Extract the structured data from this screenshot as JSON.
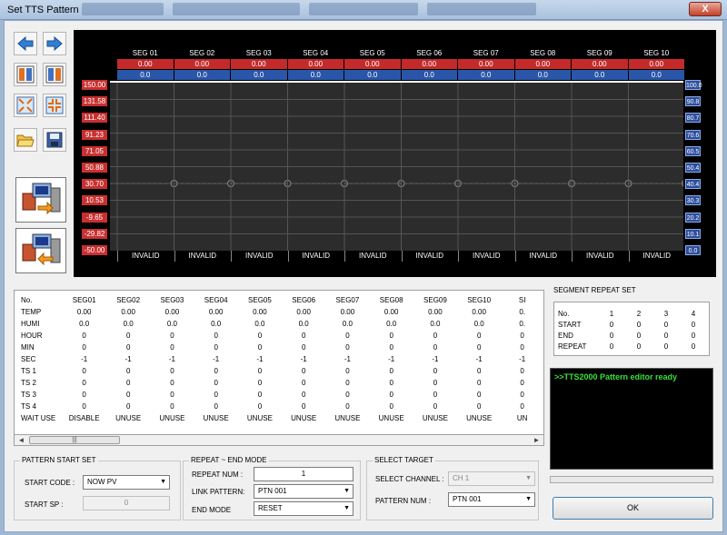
{
  "window": {
    "title": "Set TTS Pattern",
    "close_label": "X"
  },
  "graph": {
    "left_axis": [
      "150.00",
      "131.58",
      "111.40",
      "91.23",
      "71.05",
      "50.88",
      "30.70",
      "10.53",
      "-9.65",
      "-29.82",
      "-50.00"
    ],
    "right_axis": [
      "100.0",
      "90.8",
      "80.7",
      "70.6",
      "60.5",
      "50.4",
      "40.4",
      "30.3",
      "20.2",
      "10.1",
      "0.0"
    ],
    "segments": [
      {
        "name": "SEG 01",
        "temp": "0.00",
        "humi": "0.0",
        "status": "INVALID"
      },
      {
        "name": "SEG 02",
        "temp": "0.00",
        "humi": "0.0",
        "status": "INVALID"
      },
      {
        "name": "SEG 03",
        "temp": "0.00",
        "humi": "0.0",
        "status": "INVALID"
      },
      {
        "name": "SEG 04",
        "temp": "0.00",
        "humi": "0.0",
        "status": "INVALID"
      },
      {
        "name": "SEG 05",
        "temp": "0.00",
        "humi": "0.0",
        "status": "INVALID"
      },
      {
        "name": "SEG 06",
        "temp": "0.00",
        "humi": "0.0",
        "status": "INVALID"
      },
      {
        "name": "SEG 07",
        "temp": "0.00",
        "humi": "0.0",
        "status": "INVALID"
      },
      {
        "name": "SEG 08",
        "temp": "0.00",
        "humi": "0.0",
        "status": "INVALID"
      },
      {
        "name": "SEG 09",
        "temp": "0.00",
        "humi": "0.0",
        "status": "INVALID"
      },
      {
        "name": "SEG 10",
        "temp": "0.00",
        "humi": "0.0",
        "status": "INVALID"
      }
    ]
  },
  "table": {
    "headers": [
      "No.",
      "SEG01",
      "SEG02",
      "SEG03",
      "SEG04",
      "SEG05",
      "SEG06",
      "SEG07",
      "SEG08",
      "SEG09",
      "SEG10",
      "SI"
    ],
    "rows": [
      {
        "label": "TEMP",
        "cells": [
          "0.00",
          "0.00",
          "0.00",
          "0.00",
          "0.00",
          "0.00",
          "0.00",
          "0.00",
          "0.00",
          "0.00",
          "0."
        ]
      },
      {
        "label": "HUMI",
        "cells": [
          "0.0",
          "0.0",
          "0.0",
          "0.0",
          "0.0",
          "0.0",
          "0.0",
          "0.0",
          "0.0",
          "0.0",
          "0."
        ]
      },
      {
        "label": "HOUR",
        "cells": [
          "0",
          "0",
          "0",
          "0",
          "0",
          "0",
          "0",
          "0",
          "0",
          "0",
          "0"
        ]
      },
      {
        "label": "MIN",
        "cells": [
          "0",
          "0",
          "0",
          "0",
          "0",
          "0",
          "0",
          "0",
          "0",
          "0",
          "0"
        ]
      },
      {
        "label": "SEC",
        "cells": [
          "-1",
          "-1",
          "-1",
          "-1",
          "-1",
          "-1",
          "-1",
          "-1",
          "-1",
          "-1",
          "-1"
        ]
      },
      {
        "label": "TS 1",
        "cells": [
          "0",
          "0",
          "0",
          "0",
          "0",
          "0",
          "0",
          "0",
          "0",
          "0",
          "0"
        ]
      },
      {
        "label": "TS 2",
        "cells": [
          "0",
          "0",
          "0",
          "0",
          "0",
          "0",
          "0",
          "0",
          "0",
          "0",
          "0"
        ]
      },
      {
        "label": "TS 3",
        "cells": [
          "0",
          "0",
          "0",
          "0",
          "0",
          "0",
          "0",
          "0",
          "0",
          "0",
          "0"
        ]
      },
      {
        "label": "TS 4",
        "cells": [
          "0",
          "0",
          "0",
          "0",
          "0",
          "0",
          "0",
          "0",
          "0",
          "0",
          "0"
        ]
      },
      {
        "label": "WAIT USE",
        "cells": [
          "DISABLE",
          "UNUSE",
          "UNUSE",
          "UNUSE",
          "UNUSE",
          "UNUSE",
          "UNUSE",
          "UNUSE",
          "UNUSE",
          "UNUSE",
          "UN"
        ]
      }
    ],
    "scroll_left": "◄",
    "scroll_thumb": "|||",
    "scroll_right": "►"
  },
  "segment_repeat": {
    "title": "SEGMENT REPEAT SET",
    "headers": [
      "No.",
      "1",
      "2",
      "3",
      "4"
    ],
    "rows": [
      {
        "label": "START",
        "cells": [
          "0",
          "0",
          "0",
          "0"
        ]
      },
      {
        "label": "END",
        "cells": [
          "0",
          "0",
          "0",
          "0"
        ]
      },
      {
        "label": "REPEAT",
        "cells": [
          "0",
          "0",
          "0",
          "0"
        ]
      }
    ]
  },
  "console": {
    "message": ">>TTS2000 Pattern editor ready"
  },
  "pattern_start": {
    "title": "PATTERN START SET",
    "start_code_label": "START CODE :",
    "start_code_value": "NOW PV",
    "start_sp_label": "START SP :",
    "start_sp_value": "0"
  },
  "repeat_end": {
    "title": "REPEAT ~ END MODE",
    "repeat_num_label": "REPEAT NUM :",
    "repeat_num_value": "1",
    "link_pattern_label": "LINK PATTERN:",
    "link_pattern_value": "PTN 001",
    "end_mode_label": "END MODE",
    "end_mode_value": "RESET"
  },
  "select_target": {
    "title": "SELECT TARGET",
    "channel_label": "SELECT CHANNEL :",
    "channel_value": "CH 1",
    "pattern_num_label": "PATTERN NUM :",
    "pattern_num_value": "PTN 001"
  },
  "ok_label": "OK"
}
